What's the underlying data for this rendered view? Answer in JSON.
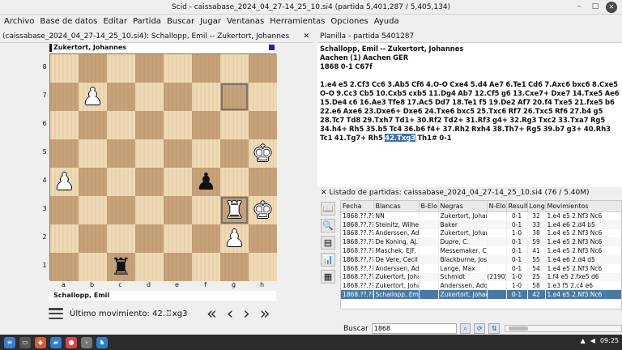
{
  "window": {
    "title": "Scid - caissabase_2024_04_27-14_25_10.si4 (partida 5,401,287 / 5,405,134)",
    "min": "–",
    "max": "□",
    "close": "✕"
  },
  "menu": [
    "Archivo",
    "Base de datos",
    "Editar",
    "Partida",
    "Buscar",
    "Jugar",
    "Ventanas",
    "Herramientas",
    "Opciones",
    "Ayuda"
  ],
  "board_pane": {
    "title": "(caissabase_2024_04_27-14_25_10.si4): Schallopp, Emil -- Zukertort, Johannes",
    "top_player": "Zukertort, Johannes",
    "bottom_player": "Schallopp, Emil",
    "last_move_label": "Último movimiento: 42.♖xg3",
    "ranks": [
      "8",
      "7",
      "6",
      "5",
      "4",
      "3",
      "2",
      "1"
    ],
    "files": [
      "a",
      "b",
      "c",
      "d",
      "e",
      "f",
      "g",
      "h"
    ],
    "pieces": [
      {
        "sq": "b7",
        "glyph": "♟",
        "color": "w"
      },
      {
        "sq": "h5",
        "glyph": "♚",
        "color": "w"
      },
      {
        "sq": "a4",
        "glyph": "♟",
        "color": "w"
      },
      {
        "sq": "f4",
        "glyph": "♟",
        "color": "b"
      },
      {
        "sq": "g3",
        "glyph": "♜",
        "color": "w"
      },
      {
        "sq": "h3",
        "glyph": "♚",
        "color": "w"
      },
      {
        "sq": "g2",
        "glyph": "♟",
        "color": "w"
      },
      {
        "sq": "c1",
        "glyph": "♜",
        "color": "b"
      }
    ],
    "highlight": [
      "g7",
      "g3"
    ],
    "nav": [
      "«",
      "‹",
      "›",
      "»"
    ]
  },
  "notation_pane": {
    "title": "Planilla - partida 5401287",
    "header_line1": "Schallopp, Emil   --   Zukertort, Johannes",
    "header_line2": "Aachen (1)  Aachen GER",
    "header_line3": "1868  0-1  C67f",
    "moves_before": "1.e4 e5 2.Cf3 Cc6 3.Ab5 Cf6 4.O-O Cxe4 5.d4 Ae7 6.Te1 Cd6 7.Axc6 bxc6 8.Cxe5 O-O 9.Cc3 Cb5 10.Cxb5 cxb5 11.Dg4 Ab7 12.Cf5 g6 13.Cxe7+ Dxe7 14.Txe5 Ae6 15.De4 c6 16.Ae3 Tfe8 17.Ac5 Dd7 18.Te1 f5 19.De2 Af7 20.f4 Txe5 21.fxe5 b6 22.e6 Axe6 23.Dxe6+ Dxe6 24.Txe6 bxc5 25.Txc6 Rf7 26.Txc5 Rf6 27.b4 g5 28.Tc7 Td8 29.Txh7 Td1+ 30.Rf2 Td2+ 31.Rf3 g4+ 32.Rg3 Txc2 33.Txa7 Rg5 34.h4+ Rh5 35.b5 Tc4 36.b6 f4+ 37.Rh2 Rxh4 38.Th7+ Rg5 39.b7 g3+ 40.Rh3 Tc1 41.Tg7+ Rh5 ",
    "moves_current": "42.Txg3",
    "moves_after": " Th1# 0-1"
  },
  "list_pane": {
    "title": "Listado de partidas: caissabase_2024_04_27-14_25_10.si4 (76 / 5.40M)",
    "columns": [
      "Fecha",
      "Blancas",
      "B-Elo",
      "Negras",
      "N-Elo",
      "Resultado",
      "Long",
      "Movimientos"
    ],
    "rows": [
      [
        "1868.??.??",
        "NN",
        "",
        "Zukertort, Johannes",
        "",
        "0-1",
        "32",
        "1.e4 e5 2.Nf3 Nc6"
      ],
      [
        "1868.??.??",
        "Steinitz, Wilhelm",
        "",
        "Baker",
        "",
        "0-1",
        "33",
        "1.e4 e6 2.d4 b5"
      ],
      [
        "1868.??.??",
        "Anderssen, Adolf",
        "",
        "Zukertort, Johannes",
        "",
        "1-0",
        "38",
        "1.e4 e5 2.Nf3 Nc6"
      ],
      [
        "1868.??.??",
        "De Koning, AJ.",
        "",
        "Dupre, C.",
        "",
        "0-1",
        "59",
        "1.e4 e5 2.Nf3 Nc6"
      ],
      [
        "1868.??.??",
        "Maschek, EJF.",
        "",
        "Messemaker, Christiaan",
        "",
        "0-1",
        "41",
        "1.e4 e5 2.Nf3 Nc6"
      ],
      [
        "1868.??.??",
        "De Vere, Cecil V",
        "",
        "Blackburne, Joseph",
        "",
        "0-1",
        "55",
        "1.e4 e6 2.d4 d5"
      ],
      [
        "1868.??.??",
        "Anderssen, Adolf",
        "",
        "Lange, Max",
        "",
        "0-1",
        "54",
        "1.e4 e5 2.Nf3 Nc6"
      ],
      [
        "1868.??.??",
        "Zukertort, Johannes",
        "",
        "Schmidt",
        "(2190)",
        "1-0",
        "25",
        "1.f4 e5 2.fxe5 d6"
      ],
      [
        "1868.??.??",
        "Zukertort, Johannes",
        "",
        "Anderssen, Adolf",
        "",
        "1-0",
        "58",
        "1.e3 f5 2.c4 e6"
      ],
      [
        "1868.??.??",
        "Schallopp, Emil",
        "",
        "Zukertort, Johannes",
        "",
        "0-1",
        "42",
        "1.e4 e5 2.Nf3 Nc6"
      ]
    ],
    "selected_row": 9,
    "search_label": "Buscar",
    "search_value": "1868"
  },
  "taskbar": {
    "time": "09:25"
  }
}
